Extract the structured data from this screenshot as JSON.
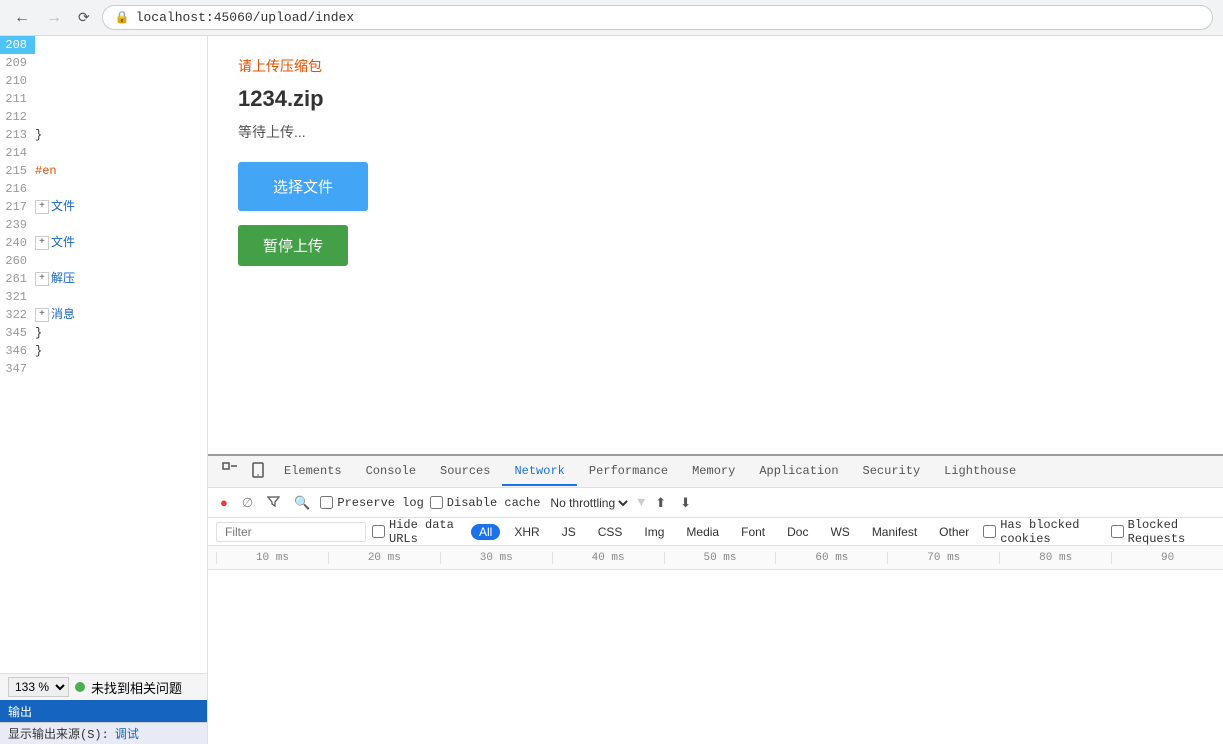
{
  "browser": {
    "back_disabled": false,
    "forward_disabled": true,
    "url": "localhost:45060/upload/index"
  },
  "code_editor": {
    "lines": [
      {
        "number": "208",
        "active": true,
        "expand": false,
        "text": ""
      },
      {
        "number": "209",
        "active": false,
        "expand": false,
        "text": ""
      },
      {
        "number": "210",
        "active": false,
        "expand": false,
        "text": ""
      },
      {
        "number": "211",
        "active": false,
        "expand": false,
        "text": ""
      },
      {
        "number": "212",
        "active": false,
        "expand": false,
        "text": ""
      },
      {
        "number": "213",
        "active": false,
        "expand": false,
        "text": "    }"
      },
      {
        "number": "214",
        "active": false,
        "expand": false,
        "text": ""
      },
      {
        "number": "215",
        "active": false,
        "expand": false,
        "text": "    #en"
      },
      {
        "number": "216",
        "active": false,
        "expand": false,
        "text": ""
      },
      {
        "number": "217",
        "active": false,
        "expand": true,
        "text": "文件"
      },
      {
        "number": "239",
        "active": false,
        "expand": false,
        "text": ""
      },
      {
        "number": "240",
        "active": false,
        "expand": true,
        "text": "文件"
      },
      {
        "number": "260",
        "active": false,
        "expand": false,
        "text": ""
      },
      {
        "number": "261",
        "active": false,
        "expand": true,
        "text": "解压"
      },
      {
        "number": "321",
        "active": false,
        "expand": false,
        "text": ""
      },
      {
        "number": "322",
        "active": false,
        "expand": true,
        "text": "消息"
      },
      {
        "number": "345",
        "active": false,
        "expand": false,
        "text": "    }"
      },
      {
        "number": "346",
        "active": false,
        "expand": false,
        "text": "}"
      },
      {
        "number": "347",
        "active": false,
        "expand": false,
        "text": ""
      }
    ],
    "zoom_level": "133 %",
    "status": "未找到相关问题"
  },
  "output_panel": {
    "title": "输出",
    "source_label": "显示输出来源(S):",
    "source_value": "调试"
  },
  "page_content": {
    "upload_label": "请上传压缩包",
    "filename": "1234.zip",
    "status": "等待上传...",
    "btn_select": "选择文件",
    "btn_pause": "暂停上传"
  },
  "devtools": {
    "tabs": [
      "Elements",
      "Console",
      "Sources",
      "Network",
      "Performance",
      "Memory",
      "Application",
      "Security",
      "Lighthouse"
    ],
    "active_tab": "Network",
    "toolbar": {
      "preserve_log": "Preserve log",
      "disable_cache": "Disable cache",
      "throttle": "No throttling",
      "import_label": "Import",
      "export_label": "Export"
    },
    "filter": {
      "placeholder": "Filter",
      "hide_data_urls": "Hide data URLs",
      "tags": [
        "All",
        "XHR",
        "JS",
        "CSS",
        "Img",
        "Media",
        "Font",
        "Doc",
        "WS",
        "Manifest",
        "Other"
      ],
      "active_tag": "All",
      "has_blocked": "Has blocked cookies",
      "blocked_requests": "Blocked Requests"
    },
    "timeline": {
      "marks": [
        "10 ms",
        "20 ms",
        "30 ms",
        "40 ms",
        "50 ms",
        "60 ms",
        "70 ms",
        "80 ms",
        "90"
      ]
    }
  }
}
